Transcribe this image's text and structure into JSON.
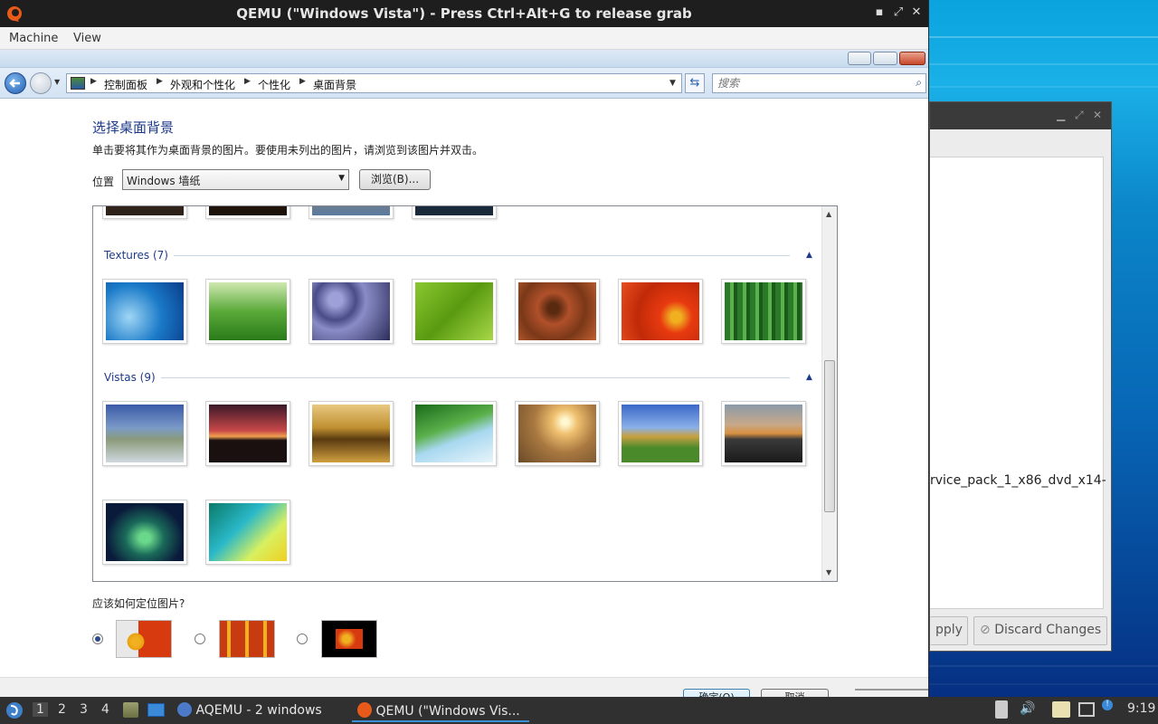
{
  "qemu": {
    "title": "QEMU (\"Windows Vista\") - Press Ctrl+Alt+G to release grab",
    "menu": [
      "Machine",
      "View"
    ],
    "controls": {
      "minimize": "▪",
      "restore": "⤢",
      "close": "✕"
    }
  },
  "vista": {
    "breadcrumbs": [
      "控制面板",
      "外观和个性化",
      "个性化",
      "桌面背景"
    ],
    "search_placeholder": "搜索",
    "heading": "选择桌面背景",
    "description": "单击要将其作为桌面背景的图片。要使用未列出的图片，请浏览到该图片并双击。",
    "location_label": "位置",
    "location_value": "Windows 墙纸",
    "browse_label": "浏览(B)...",
    "groups": [
      {
        "name": "Textures (7)",
        "images": [
          "fish",
          "grass",
          "pebbles",
          "leaf",
          "wood",
          "daisy",
          "bamboo"
        ]
      },
      {
        "name": "Vistas (9)",
        "images": [
          "river",
          "sunset",
          "rocks",
          "palm",
          "field",
          "hills",
          "lake",
          "aurora",
          "vista-waves"
        ]
      }
    ],
    "position_label": "应该如何定位图片?",
    "ok_label": "确定(O)",
    "cancel_label": "取消"
  },
  "background_window": {
    "iso_text": "rvice_pack_1_x86_dvd_x14-",
    "apply_label": "pply",
    "discard_label": "Discard Changes"
  },
  "taskbar": {
    "workspaces": [
      "1",
      "2",
      "3",
      "4"
    ],
    "tasks": [
      "AQEMU - 2 windows",
      "QEMU (\"Windows Vis..."
    ],
    "clock": "9:19"
  }
}
